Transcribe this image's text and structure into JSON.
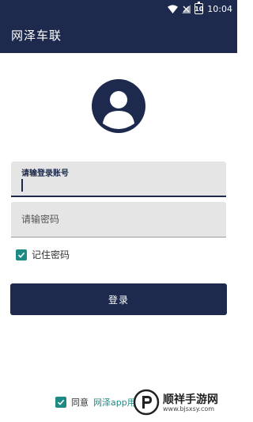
{
  "status_bar": {
    "time": "10:04",
    "battery_level": "10",
    "icons": [
      "wifi-icon",
      "signal-icon",
      "battery-icon"
    ]
  },
  "app_bar": {
    "title": "网泽车联"
  },
  "login_form": {
    "avatar_icon": "user-avatar-icon",
    "account_placeholder": "请输登录账号",
    "password_placeholder": "请输密码",
    "remember_label": "记住密码",
    "remember_checked": true,
    "login_label": "登录"
  },
  "agreement": {
    "agree_label": "同意",
    "link_text": "网泽app用",
    "checked": true
  },
  "watermark": {
    "title": "顺祥手游网",
    "url": "www.bjsxsy.com"
  },
  "colors": {
    "primary": "#1d2a4d",
    "accent": "#1f8a83",
    "field_bg": "#e5e5e5"
  }
}
